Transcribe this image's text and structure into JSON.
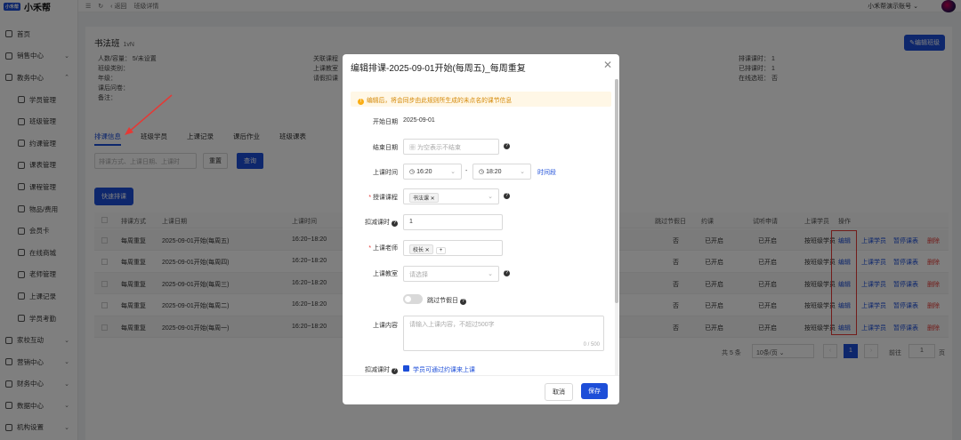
{
  "app": {
    "logo_badge": "小禾帮",
    "name": "小禾帮"
  },
  "topbar": {
    "back": "返回",
    "breadcrumb": "班级详情",
    "account": "小禾帮演示账号"
  },
  "sidebar": {
    "items": [
      {
        "label": "首页"
      },
      {
        "label": "销售中心"
      },
      {
        "label": "教务中心"
      },
      {
        "label": "学员管理"
      },
      {
        "label": "班级管理"
      },
      {
        "label": "约课管理"
      },
      {
        "label": "课表管理"
      },
      {
        "label": "课程管理"
      },
      {
        "label": "物品/费用"
      },
      {
        "label": "会员卡"
      },
      {
        "label": "在线商城"
      },
      {
        "label": "老师管理"
      },
      {
        "label": "上课记录"
      },
      {
        "label": "学员考勤"
      },
      {
        "label": "家校互动"
      },
      {
        "label": "营销中心"
      },
      {
        "label": "财务中心"
      },
      {
        "label": "数据中心"
      },
      {
        "label": "机构设置"
      }
    ]
  },
  "class_info": {
    "title": "书法班",
    "type": "1vN",
    "edit_button": "编辑班级",
    "capacity": "人数/容量： 5/未设置",
    "category": "班级类别：",
    "grade": "年级：",
    "after_class": "课后问卷：",
    "remark": "备注：",
    "linked_course": "关联课程",
    "classroom": "上课教室",
    "leave_rule": "请假扣课",
    "scheduled_hours": "排课课时： 1",
    "done_hours": "已排课时： 1",
    "online": "在线选班： 否"
  },
  "tabs": [
    "排课信息",
    "班级学员",
    "上课记录",
    "课后作业",
    "班级课表"
  ],
  "filter": {
    "placeholder": "排课方式、上课日期、上课时",
    "reset": "重置",
    "query": "查询"
  },
  "quick_schedule": "快速排课",
  "table": {
    "headers": [
      "排课方式",
      "上课日期",
      "上课时间",
      "跳过节假日",
      "约课",
      "试听申请",
      "上课学员",
      "操作"
    ],
    "rows": [
      {
        "mode": "每周重复",
        "date": "2025-09-01开始(每周五)",
        "time": "16:20~18:20",
        "skip": "否",
        "booking": "已开启",
        "trial": "已开启",
        "students": "按班级学员"
      },
      {
        "mode": "每周重复",
        "date": "2025-09-01开始(每周四)",
        "time": "16:20~18:20",
        "skip": "否",
        "booking": "已开启",
        "trial": "已开启",
        "students": "按班级学员"
      },
      {
        "mode": "每周重复",
        "date": "2025-09-01开始(每周三)",
        "time": "16:20~18:20",
        "skip": "否",
        "booking": "已开启",
        "trial": "已开启",
        "students": "按班级学员"
      },
      {
        "mode": "每周重复",
        "date": "2025-09-01开始(每周二)",
        "time": "16:20~18:20",
        "skip": "否",
        "booking": "已开启",
        "trial": "已开启",
        "students": "按班级学员"
      },
      {
        "mode": "每周重复",
        "date": "2025-09-01开始(每周一)",
        "time": "16:20~18:20",
        "skip": "否",
        "booking": "已开启",
        "trial": "已开启",
        "students": "按班级学员"
      }
    ],
    "actions": {
      "edit": "编辑",
      "students": "上课学员",
      "pause": "暂停课表",
      "delete": "删除"
    }
  },
  "pager": {
    "total": "共 5 条",
    "page_size": "10条/页",
    "current": "1",
    "goto": "前往",
    "goto_value": "1",
    "page_unit": "页"
  },
  "modal": {
    "title": "编辑排课-2025-09-01开始(每周五)_每周重复",
    "warning": "编辑后，将会同步由此规则所生成的未点名的课节信息",
    "start_label": "开始日期",
    "start_value": "2025-09-01",
    "end_label": "结束日期",
    "end_placeholder": "为空表示不结束",
    "time_label": "上课时间",
    "time_start": "16:20",
    "time_end": "18:20",
    "time_sep": "-",
    "time_link": "时间段",
    "course_label": "授课课程",
    "course_tag": "书法课",
    "deduct_label": "扣减课时",
    "deduct_value": "1",
    "teacher_label": "上课老师",
    "teacher_tag": "校长",
    "teacher_add": "+",
    "room_label": "上课教室",
    "room_placeholder": "请选择",
    "skip_label": "跳过节假日",
    "content_label": "上课内容",
    "content_placeholder": "请输入上课内容，不超过500字",
    "content_count": "0 / 500",
    "booking_label": "扣减课时",
    "booking_check": "学员可通过约课来上课",
    "cancel": "取消",
    "save": "保存"
  }
}
